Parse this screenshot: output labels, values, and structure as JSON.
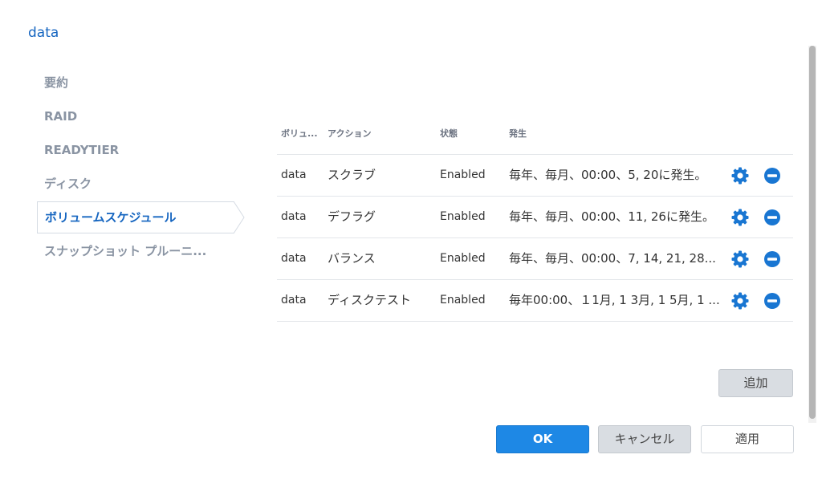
{
  "dialog": {
    "title": "data"
  },
  "sidebar": {
    "items": [
      {
        "label": "要約"
      },
      {
        "label": "RAID"
      },
      {
        "label": "READYTIER"
      },
      {
        "label": "ディスク"
      },
      {
        "label": "ボリュームスケジュール"
      },
      {
        "label": "スナップショット プルーニ..."
      }
    ],
    "active_index": 4
  },
  "table": {
    "headers": {
      "volume": "ボリュ...",
      "action": "アクション",
      "state": "状態",
      "occurrence": "発生"
    },
    "rows": [
      {
        "volume": "data",
        "action": "スクラブ",
        "state": "Enabled",
        "occurrence": "毎年、毎月、00:00、5, 20に発生。"
      },
      {
        "volume": "data",
        "action": "デフラグ",
        "state": "Enabled",
        "occurrence": "毎年、毎月、00:00、11, 26に発生。"
      },
      {
        "volume": "data",
        "action": "バランス",
        "state": "Enabled",
        "occurrence": "毎年、毎月、00:00、7, 14, 21, 28..."
      },
      {
        "volume": "data",
        "action": "ディスクテスト",
        "state": "Enabled",
        "occurrence": "毎年00:00、１1月, 1 3月, 1 5月, 1 ..."
      }
    ],
    "row_icons": [
      "gear-icon",
      "minus-circle-icon"
    ]
  },
  "buttons": {
    "add": "追加",
    "ok": "OK",
    "cancel": "キャンセル",
    "apply": "適用"
  },
  "colors": {
    "accent": "#1e88e5",
    "title": "#1565c0",
    "icon_blue": "#1976d2"
  }
}
